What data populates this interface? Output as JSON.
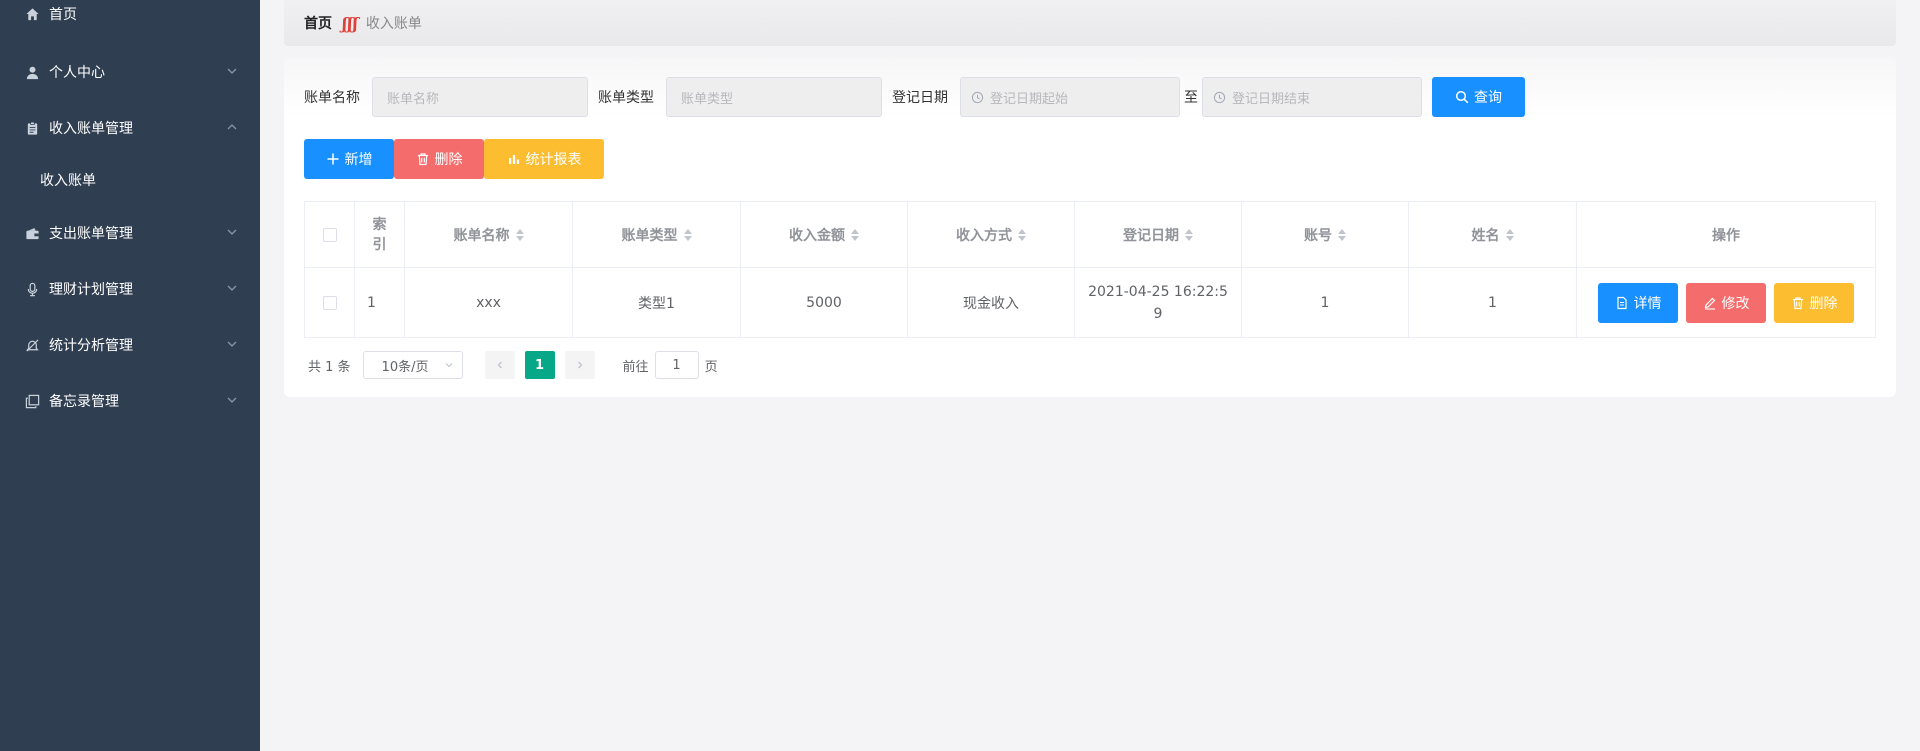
{
  "sidebar": {
    "items": [
      {
        "label": "首页",
        "icon": "home-icon"
      },
      {
        "label": "个人中心",
        "icon": "user-icon"
      },
      {
        "label": "收入账单管理",
        "icon": "clipboard-icon"
      },
      {
        "label": "收入账单",
        "icon": ""
      },
      {
        "label": "支出账单管理",
        "icon": "wallet-icon"
      },
      {
        "label": "理财计划管理",
        "icon": "microphone-icon"
      },
      {
        "label": "统计分析管理",
        "icon": "bell-off-icon"
      },
      {
        "label": "备忘录管理",
        "icon": "copy-icon"
      }
    ]
  },
  "breadcrumb": {
    "home": "首页",
    "separator": "ʃʃʃ",
    "current": "收入账单"
  },
  "search": {
    "name_label": "账单名称",
    "name_placeholder": "账单名称",
    "type_label": "账单类型",
    "type_placeholder": "账单类型",
    "date_label": "登记日期",
    "date_start_placeholder": "登记日期起始",
    "date_to": "至",
    "date_end_placeholder": "登记日期结束",
    "query_label": "查询"
  },
  "actions": {
    "add": "新增",
    "delete": "删除",
    "report": "统计报表"
  },
  "table": {
    "headers": [
      "索引",
      "账单名称",
      "账单类型",
      "收入金额",
      "收入方式",
      "登记日期",
      "账号",
      "姓名",
      "操作"
    ],
    "rows": [
      {
        "index": "1",
        "name": "xxx",
        "type": "类型1",
        "amount": "5000",
        "method": "现金收入",
        "date": "2021-04-25 16:22:59",
        "account": "1",
        "person": "1",
        "detail_label": "详情",
        "edit_label": "修改",
        "delete_label": "删除"
      }
    ]
  },
  "pagination": {
    "total": "共 1 条",
    "page_size": "10条/页",
    "current_page": "1",
    "goto_label": "前往",
    "goto_value": "1",
    "page_suffix": "页"
  },
  "colors": {
    "sidebar_bg": "#2f3e50",
    "primary": "#1890ff",
    "danger": "#f56c6c",
    "warning": "#fcbd30",
    "page_active": "#07a887"
  }
}
